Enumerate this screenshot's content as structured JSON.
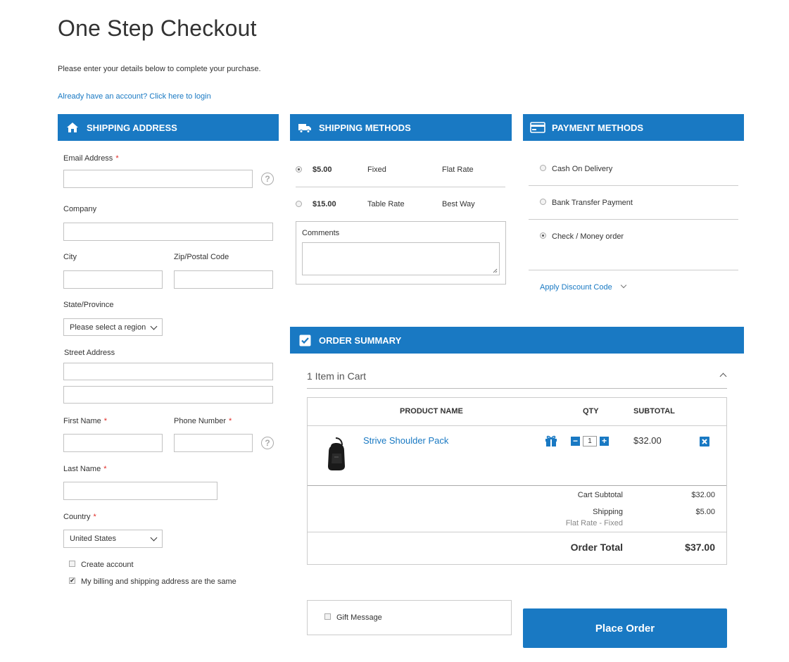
{
  "page": {
    "title": "One Step Checkout",
    "intro": "Please enter your details below to complete your purchase.",
    "login_link": "Already have an account? Click here to login"
  },
  "shipping_address": {
    "heading": "SHIPPING ADDRESS",
    "icon": "home-icon",
    "email_label": "Email Address",
    "company_label": "Company",
    "city_label": "City",
    "zip_label": "Zip/Postal Code",
    "state_label": "State/Province",
    "state_value": "Please select a region",
    "street_label": "Street Address",
    "first_name_label": "First Name",
    "phone_label": "Phone Number",
    "last_name_label": "Last Name",
    "country_label": "Country",
    "country_value": "United States",
    "create_account_label": "Create account",
    "create_account_checked": false,
    "billing_same_label": "My billing and shipping address are the same",
    "billing_same_checked": true,
    "help_glyph": "?"
  },
  "shipping_methods": {
    "heading": "SHIPPING METHODS",
    "icon": "truck-icon",
    "options": [
      {
        "price": "$5.00",
        "method": "Fixed",
        "carrier": "Flat Rate",
        "selected": true
      },
      {
        "price": "$15.00",
        "method": "Table Rate",
        "carrier": "Best Way",
        "selected": false
      }
    ],
    "comments_label": "Comments"
  },
  "payment_methods": {
    "heading": "PAYMENT METHODS",
    "icon": "credit-card-icon",
    "options": [
      {
        "label": "Cash On Delivery",
        "selected": false
      },
      {
        "label": "Bank Transfer Payment",
        "selected": false
      },
      {
        "label": "Check / Money order",
        "selected": true
      }
    ],
    "discount_link": "Apply Discount Code"
  },
  "order_summary": {
    "heading": "ORDER SUMMARY",
    "icon": "checkbox-checked-icon",
    "items_in_cart": "1 Item in Cart",
    "columns": {
      "product": "PRODUCT NAME",
      "qty": "QTY",
      "subtotal": "SUBTOTAL"
    },
    "items": [
      {
        "name": "Strive Shoulder Pack",
        "qty": "1",
        "subtotal": "$32.00"
      }
    ],
    "totals": {
      "cart_subtotal_label": "Cart Subtotal",
      "cart_subtotal_value": "$32.00",
      "shipping_label": "Shipping",
      "shipping_value": "$5.00",
      "shipping_detail": "Flat Rate - Fixed",
      "order_total_label": "Order Total",
      "order_total_value": "$37.00"
    },
    "qty_minus": "−",
    "qty_plus": "+"
  },
  "gift_message_label": "Gift Message",
  "place_order_label": "Place Order",
  "colors": {
    "accent": "#1979c3",
    "required": "#e02b27"
  }
}
